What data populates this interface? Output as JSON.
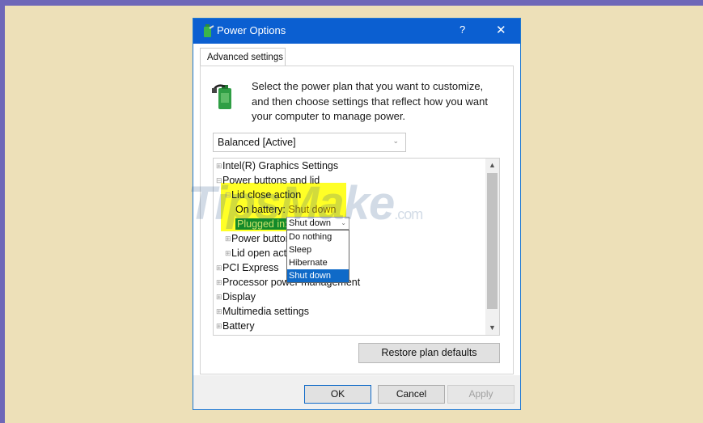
{
  "window": {
    "title": "Power Options",
    "help": "?",
    "close": "✕"
  },
  "tab": "Advanced settings",
  "intro": "Select the power plan that you want to customize, and then choose settings that reflect how you want your computer to manage power.",
  "plan_select": {
    "value": "Balanced [Active]",
    "chevron": "⌄"
  },
  "tree": {
    "intel": "Intel(R) Graphics Settings",
    "power_buttons_lid": "Power buttons and lid",
    "lid_close": "Lid close action",
    "on_battery_label": "On battery:",
    "on_battery_value": "Shut down",
    "plugged_label": "Plugged in:",
    "plugged_value": "Shut down",
    "power_button": "Power button",
    "lid_open": "Lid open actio",
    "pci": "PCI Express",
    "processor": "Processor power management",
    "display": "Display",
    "multimedia": "Multimedia settings",
    "battery": "Battery"
  },
  "dropdown_options": [
    "Do nothing",
    "Sleep",
    "Hibernate",
    "Shut down"
  ],
  "buttons": {
    "restore": "Restore plan defaults",
    "ok": "OK",
    "cancel": "Cancel",
    "apply": "Apply"
  },
  "watermark": {
    "text": "TipsMake",
    "suffix": ".com"
  },
  "colors": {
    "titlebar": "#0b5fd1",
    "highlight": "#ffff00",
    "selection": "#138a2a",
    "dropdown_selected": "#0f6ac8"
  }
}
